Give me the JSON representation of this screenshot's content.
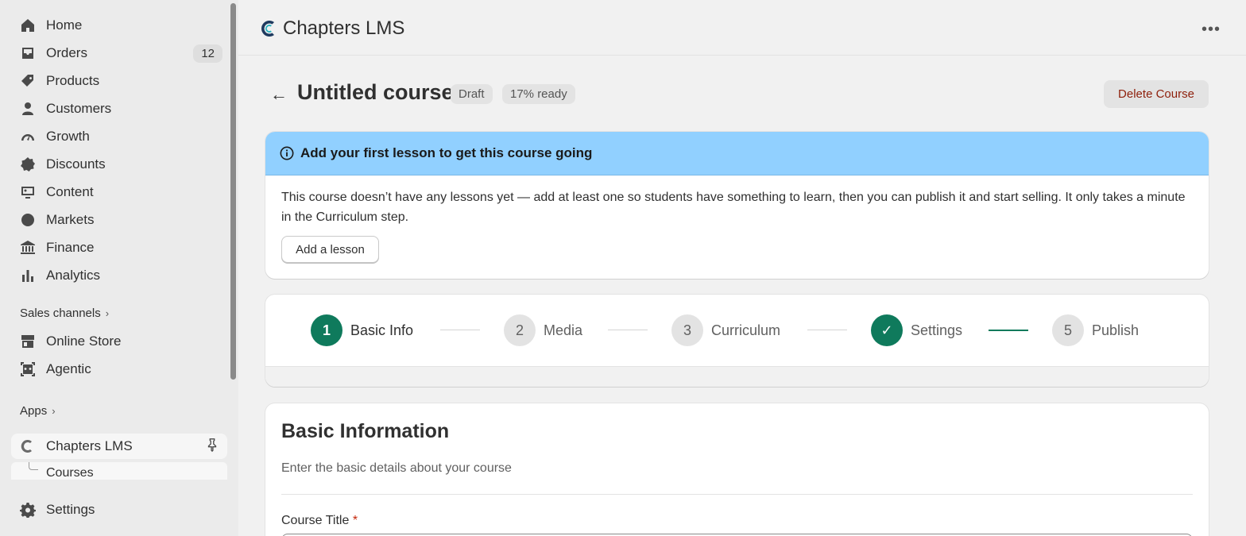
{
  "sidebar": {
    "items": [
      {
        "label": "Home",
        "icon": "home-icon"
      },
      {
        "label": "Orders",
        "icon": "inbox-icon",
        "count": "12"
      },
      {
        "label": "Products",
        "icon": "tag-icon"
      },
      {
        "label": "Customers",
        "icon": "person-icon"
      },
      {
        "label": "Growth",
        "icon": "gauge-icon"
      },
      {
        "label": "Discounts",
        "icon": "discount-icon"
      },
      {
        "label": "Content",
        "icon": "image-icon"
      },
      {
        "label": "Markets",
        "icon": "globe-icon"
      },
      {
        "label": "Finance",
        "icon": "bank-icon"
      },
      {
        "label": "Analytics",
        "icon": "bar-chart-icon"
      }
    ],
    "sales_channels_label": "Sales channels",
    "channels": [
      {
        "label": "Online Store",
        "icon": "store-icon"
      },
      {
        "label": "Agentic",
        "icon": "agent-icon"
      }
    ],
    "apps_label": "Apps",
    "app_item": {
      "label": "Chapters LMS",
      "icon": "chapters-logo-icon"
    },
    "app_sub_item": "Courses",
    "settings_label": "Settings"
  },
  "topbar": {
    "app_title": "Chapters LMS",
    "more_label": "•••"
  },
  "header": {
    "back_label": "←",
    "title": "Untitled course",
    "status_badge": "Draft",
    "ready_badge": "17% ready",
    "delete_label": "Delete Course"
  },
  "banner": {
    "title": "Add your first lesson to get this course going",
    "body": "This course doesn’t have any lessons yet — add at least one so students have something to learn, then you can publish it and start selling. It only takes a minute in the Curriculum step.",
    "button_label": "Add a lesson",
    "bg_color": "#91d0ff"
  },
  "stepper": {
    "steps": [
      {
        "number": "1",
        "label": "Basic Info",
        "state": "active"
      },
      {
        "number": "2",
        "label": "Media",
        "state": "todo"
      },
      {
        "number": "3",
        "label": "Curriculum",
        "state": "todo"
      },
      {
        "number": "✓",
        "label": "Settings",
        "state": "complete"
      },
      {
        "number": "5",
        "label": "Publish",
        "state": "todo"
      }
    ],
    "accent_color": "#0f7a5c"
  },
  "basic_info": {
    "title": "Basic Information",
    "subtitle": "Enter the basic details about your course",
    "course_title_label": "Course Title",
    "required_mark": "*"
  }
}
